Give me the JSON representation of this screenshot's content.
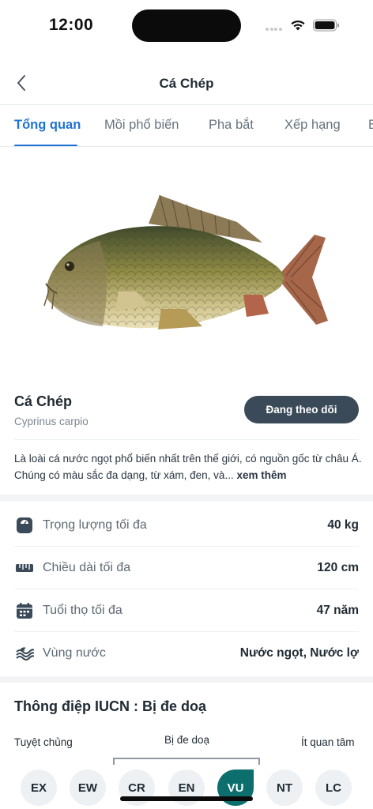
{
  "status_bar": {
    "time": "12:00"
  },
  "nav": {
    "title": "Cá Chép"
  },
  "tabs": [
    {
      "label": "Tổng quan",
      "active": true
    },
    {
      "label": "Mồi phổ biến",
      "active": false
    },
    {
      "label": "Pha bắt",
      "active": false
    },
    {
      "label": "Xếp hạng",
      "active": false
    },
    {
      "label": "B",
      "active": false
    }
  ],
  "species": {
    "name": "Cá Chép",
    "scientific_name": "Cyprinus carpio",
    "follow_label": "Đang theo dõi",
    "description": "Là loài cá nước ngọt phổ biến nhất trên thế giới, có nguồn gốc từ châu Á. Chúng có màu sắc đa dạng, từ xám, đen, và...",
    "more_label": "xem thêm"
  },
  "stats": [
    {
      "icon": "scale-icon",
      "label": "Trọng lượng tối đa",
      "value": "40 kg"
    },
    {
      "icon": "ruler-icon",
      "label": "Chiều dài tối đa",
      "value": "120 cm"
    },
    {
      "icon": "calendar-icon",
      "label": "Tuổi thọ tối đa",
      "value": "47 năm"
    },
    {
      "icon": "water-waves-icon",
      "label": "Vùng nước",
      "value": "Nước ngọt, Nước lợ"
    }
  ],
  "iucn": {
    "title": "Thông điệp IUCN : Bị đe doạ",
    "left_label": "Tuyệt chủng",
    "mid_label": "Bị đe doạ",
    "right_label": "Ít quan tâm",
    "levels": [
      "EX",
      "EW",
      "CR",
      "EN",
      "VU",
      "NT",
      "LC"
    ],
    "current": "VU",
    "active_color": "#0d6e6e"
  },
  "colors": {
    "accent": "#1f73d6",
    "button": "#3a4a58"
  }
}
